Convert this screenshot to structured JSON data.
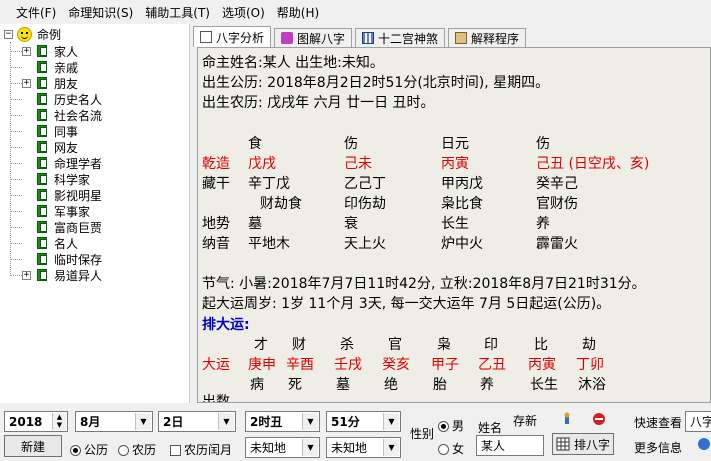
{
  "menu": [
    "文件(F)",
    "命理知识(S)",
    "辅助工具(T)",
    "选项(O)",
    "帮助(H)"
  ],
  "tree": {
    "root": "命例",
    "items": [
      "家人",
      "亲戚",
      "朋友",
      "历史名人",
      "社会名流",
      "同事",
      "网友",
      "命理学者",
      "科学家",
      "影视明星",
      "军事家",
      "富商巨贾",
      "名人",
      "临时保存",
      "易道异人"
    ]
  },
  "tabs": [
    "八字分析",
    "图解八字",
    "十二宫神煞",
    "解释程序"
  ],
  "content": {
    "l1": "命主姓名:某人   出生地:未知。",
    "l2": "出生公历: 2018年8月2日2时51分(北京时间), 星期四。",
    "l3": "出生农历: 戊戌年 六月 廿一日 丑时。",
    "gods": [
      "食",
      "伤",
      "日元",
      "伤"
    ],
    "qianzao_label": "乾造",
    "pillars": [
      "戊戌",
      "己未",
      "丙寅",
      "己丑 (日空戌、亥)"
    ],
    "canggan_label": "藏干",
    "canggan": [
      "辛丁戊",
      "乙己丁",
      "甲丙戊",
      "癸辛己"
    ],
    "canggan_gods": [
      "财劫食",
      "印伤劫",
      "枭比食",
      "官财伤"
    ],
    "dishi_label": "地势",
    "dishi": [
      "墓",
      "衰",
      "长生",
      "养"
    ],
    "nayin_label": "纳音",
    "nayin": [
      "平地木",
      "天上火",
      "炉中火",
      "霹雷火"
    ],
    "jieqi": "节气: 小暑:2018年7月7日11时42分, 立秋:2018年8月7日21时31分。",
    "qiyun": "起大运周岁: 1岁 11个月 3天, 每一交大运年 7月 5日起运(公历)。",
    "dayun_title": "排大运:",
    "dayun_gods": [
      "才",
      "财",
      "杀",
      "官",
      "枭",
      "印",
      "比",
      "劫"
    ],
    "dayun_label": "大运",
    "dayun": [
      "庚申",
      "辛酉",
      "壬戌",
      "癸亥",
      "甲子",
      "乙丑",
      "丙寅",
      "丁卯"
    ],
    "dayun_state": [
      "病",
      "死",
      "墓",
      "绝",
      "胎",
      "养",
      "长生",
      "沐浴"
    ],
    "partial_label": "出数"
  },
  "form": {
    "year": "2018",
    "month": "8月",
    "day": "2日",
    "hour": "2时丑",
    "minute": "51分",
    "male": "男",
    "female": "女",
    "gender_label": "性别",
    "name_label": "姓名",
    "name_value": "某人",
    "save_label": "存新",
    "solar": "公历",
    "lunar": "农历",
    "leap": "农历闰月",
    "place1": "未知地",
    "place2": "未知地",
    "new_btn": "新建",
    "paipan_btn": "排八字",
    "quick_label": "快速查看",
    "quick_value": "八字",
    "more_label": "更多信息"
  }
}
